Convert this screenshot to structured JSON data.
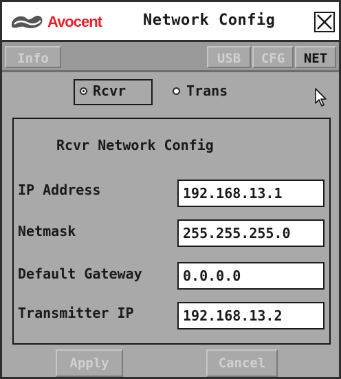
{
  "window": {
    "brand": "Avocent",
    "title": "Network Config",
    "close_icon": "close-icon",
    "logo_icon": "avocent-logo-icon",
    "accent_color": "#e8202a"
  },
  "tabs": [
    {
      "label": "Info",
      "active": false
    },
    {
      "label": "USB",
      "active": false
    },
    {
      "label": "CFG",
      "active": false
    },
    {
      "label": "NET",
      "active": true
    }
  ],
  "mode": {
    "options": [
      {
        "label": "Rcvr",
        "selected": true
      },
      {
        "label": "Trans",
        "selected": false
      }
    ]
  },
  "config": {
    "heading": "Rcvr Network Config",
    "fields": [
      {
        "label": "IP Address",
        "value": "192.168.13.1"
      },
      {
        "label": "Netmask",
        "value": "255.255.255.0"
      },
      {
        "label": "Default Gateway",
        "value": "0.0.0.0"
      },
      {
        "label": "Transmitter IP",
        "value": "192.168.13.2"
      }
    ]
  },
  "actions": {
    "apply_label": "Apply",
    "cancel_label": "Cancel"
  },
  "cursor_icon": "pointer-cursor-icon"
}
